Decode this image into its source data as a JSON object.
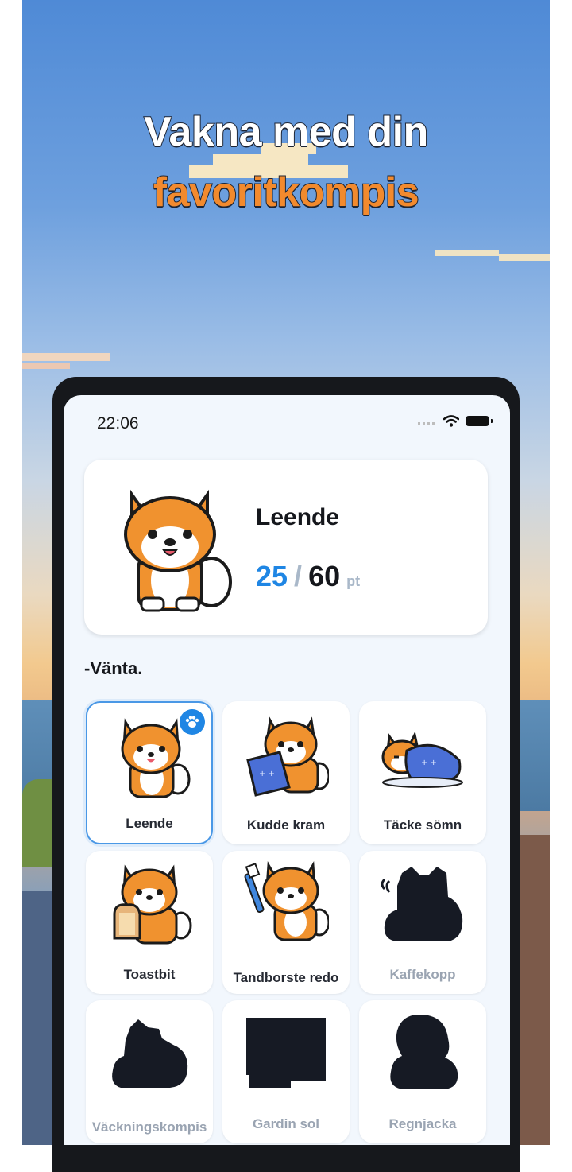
{
  "promo": {
    "headline_line1": "Vakna med din",
    "headline_line2": "favoritkompis",
    "line1_color": "#ffffff",
    "line2_color": "#f28a2e"
  },
  "status_bar": {
    "time": "22:06",
    "icons": [
      "signal-dots-icon",
      "wifi-icon",
      "battery-icon"
    ]
  },
  "hero": {
    "name": "Leende",
    "score_current": "25",
    "score_separator": "/",
    "score_max": "60",
    "score_unit": "pt"
  },
  "section": {
    "title": "-Vänta."
  },
  "collection": [
    {
      "label": "Leende",
      "locked": false,
      "selected": true,
      "badge": "paw-icon"
    },
    {
      "label": "Kudde kram",
      "locked": false,
      "selected": false
    },
    {
      "label": "Täcke sömn",
      "locked": false,
      "selected": false
    },
    {
      "label": "Toastbit",
      "locked": false,
      "selected": false
    },
    {
      "label": "Tandborste redo",
      "locked": false,
      "selected": false
    },
    {
      "label": "Kaffekopp",
      "locked": true,
      "selected": false
    },
    {
      "label": "Väckningskompis",
      "locked": true,
      "selected": false
    },
    {
      "label": "Gardin sol",
      "locked": true,
      "selected": false
    },
    {
      "label": "Regnjacka",
      "locked": true,
      "selected": false
    }
  ],
  "colors": {
    "accent": "#1f86e4",
    "pet_orange": "#f0922f",
    "locked_text": "#9aa4b2"
  }
}
